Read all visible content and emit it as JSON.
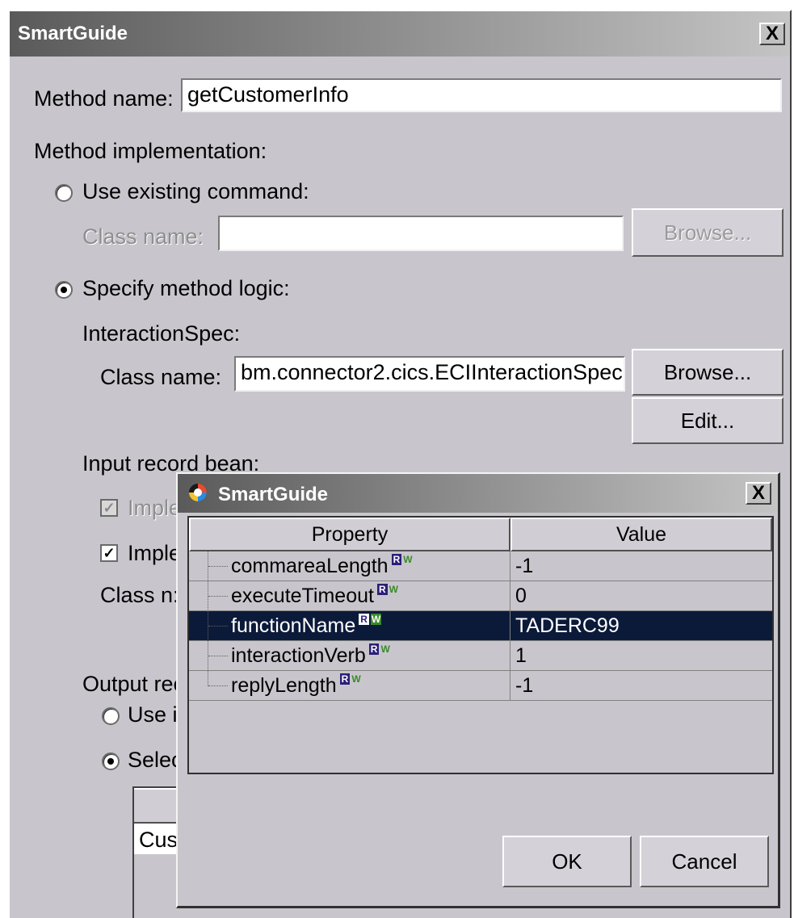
{
  "main_window": {
    "title": "SmartGuide",
    "close_glyph": "X",
    "method_name_label": "Method name:",
    "method_name_value": "getCustomerInfo",
    "method_impl_label": "Method implementation:",
    "use_existing_label": "Use existing command:",
    "existing_class_label": "Class name:",
    "existing_class_value": "",
    "existing_browse_label": "Browse...",
    "specify_logic_label": "Specify method logic:",
    "interaction_spec_label": "InteractionSpec:",
    "spec_class_label": "Class name:",
    "spec_class_value": "bm.connector2.cics.ECIInteractionSpec",
    "spec_browse_label": "Browse...",
    "spec_edit_label": "Edit...",
    "input_record_label": "Input record bean:",
    "impl_1_label": "Imple",
    "impl_2_label": "Imple",
    "input_class_label": "Class n:",
    "output_record_label": "Output rec",
    "use_partial_label": "Use i",
    "select_partial_label": "Selec",
    "table_cell_partial": "Cus"
  },
  "dialog": {
    "title": "SmartGuide",
    "close_glyph": "X",
    "columns": [
      "Property",
      "Value"
    ],
    "rows": [
      {
        "property": "commareaLength",
        "value": "-1",
        "selected": false
      },
      {
        "property": "executeTimeout",
        "value": "0",
        "selected": false
      },
      {
        "property": "functionName",
        "value": "TADERC99",
        "selected": true
      },
      {
        "property": "interactionVerb",
        "value": "1",
        "selected": false
      },
      {
        "property": "replyLength",
        "value": "-1",
        "selected": false
      }
    ],
    "badge_r": "R",
    "badge_w": "W",
    "ok_label": "OK",
    "cancel_label": "Cancel"
  },
  "colors": {
    "window_bg": "#c8c6cc",
    "selection": "#0c1a3a",
    "read_badge": "#2b1f78",
    "write_badge": "#3a8a2a"
  }
}
